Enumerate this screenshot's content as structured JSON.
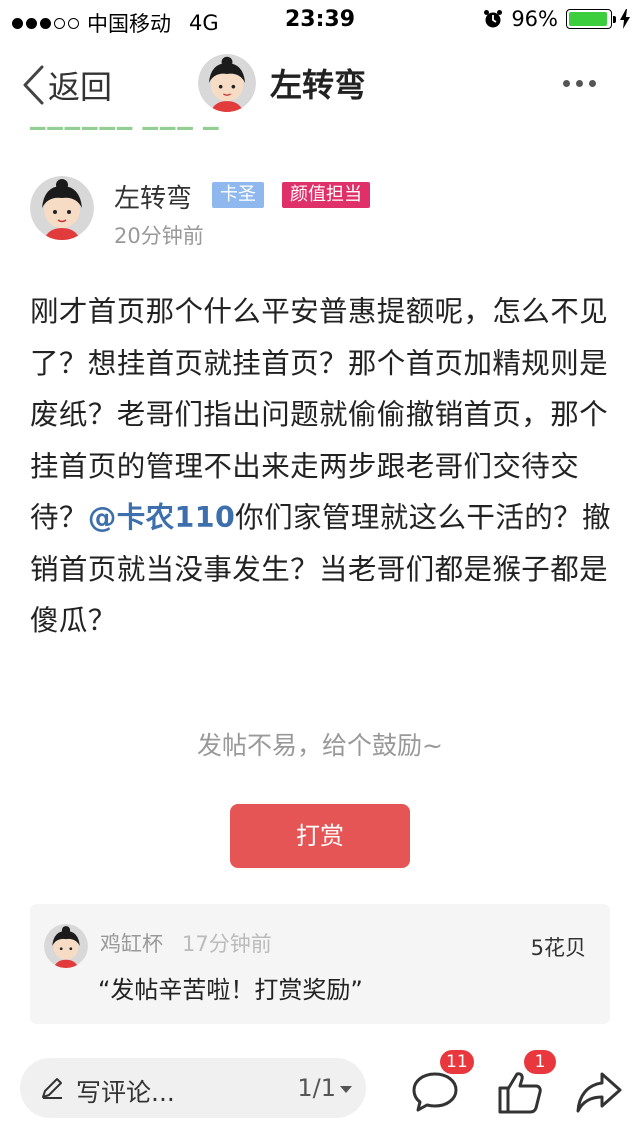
{
  "status_bar": {
    "signal_dots": "●●●○○",
    "carrier": "中国移动",
    "network": "4G",
    "time": "23:39",
    "battery_percent": "96%",
    "battery_level": 0.96
  },
  "nav": {
    "back_label": "返回",
    "title": "左转弯"
  },
  "post": {
    "author_name": "左转弯",
    "tags": [
      "卡圣",
      "颜值担当"
    ],
    "time": "20分钟前",
    "body_before_mention": "刚才首页那个什么平安普惠提额呢，怎么不见了？想挂首页就挂首页？那个首页加精规则是废纸？老哥们指出问题就偷偷撤销首页，那个挂首页的管理不出来走两步跟老哥们交待交待？",
    "mention": "@卡农110",
    "body_after_mention": "你们家管理就这么干活的？撤销首页就当没事发生？当老哥们都是猴子都是傻瓜？"
  },
  "encourage_text": "发帖不易，给个鼓励~",
  "tip_button_label": "打赏",
  "reward": {
    "user": "鸡缸杯",
    "time": "17分钟前",
    "amount": "5花贝",
    "message": "“发帖辛苦啦！打赏奖励”"
  },
  "bottom_bar": {
    "comment_placeholder": "写评论...",
    "page_indicator": "1/1",
    "comment_count": "11",
    "like_count": "1"
  },
  "colors": {
    "accent_red": "#e65556",
    "mention_blue": "#3d6fad",
    "tag_blue": "#8fb8ee",
    "tag_pink": "#e0306a",
    "badge_red": "#e8383d"
  }
}
